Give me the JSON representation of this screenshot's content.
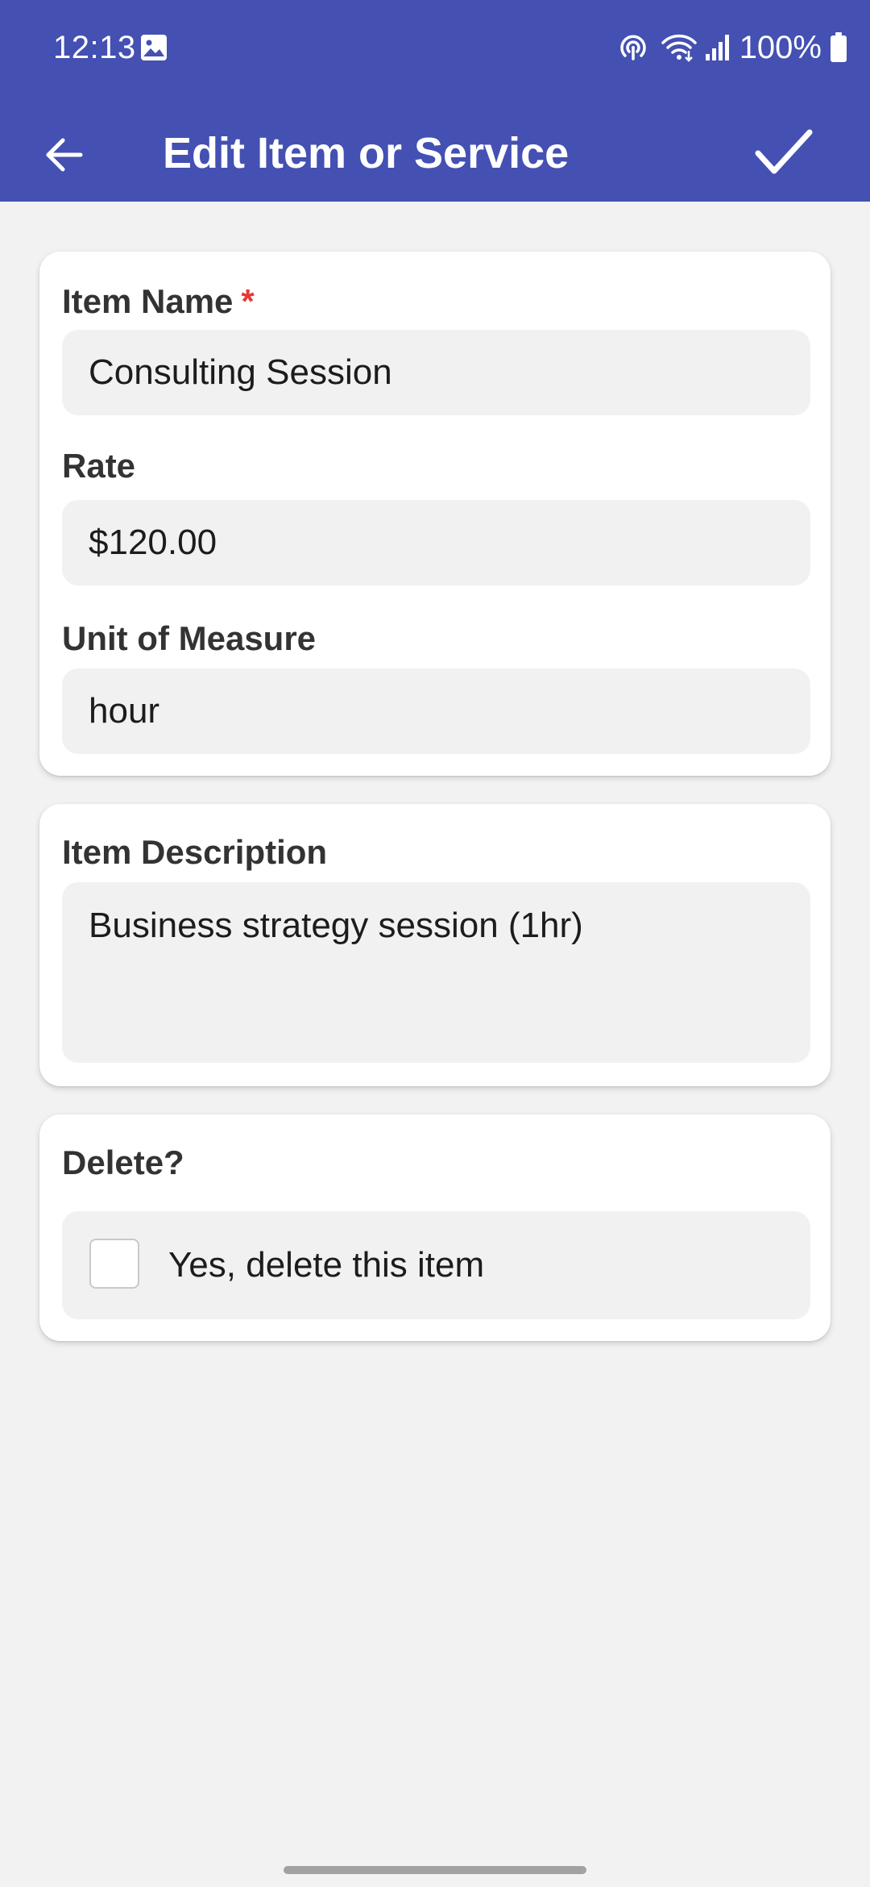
{
  "status_bar": {
    "time": "12:13",
    "battery": "100%",
    "icons": [
      "gallery-icon",
      "hotspot-icon",
      "wifi-icon",
      "signal-icon",
      "battery-icon"
    ]
  },
  "toolbar": {
    "title": "Edit Item or Service",
    "back_icon": "arrow-left-icon",
    "save_icon": "checkmark-icon"
  },
  "form": {
    "item_name": {
      "label": "Item Name",
      "required_mark": "*",
      "value": "Consulting Session"
    },
    "rate": {
      "label": "Rate",
      "value": "$120.00"
    },
    "unit": {
      "label": "Unit of Measure",
      "value": "hour"
    },
    "description": {
      "label": "Item Description",
      "value": "Business strategy session (1hr)"
    },
    "delete": {
      "label": "Delete?",
      "checkbox_label": "Yes, delete this item",
      "checked": false
    }
  },
  "colors": {
    "primary": "#4450b2",
    "background": "#f2f2f2",
    "field_background": "#f1f1f1",
    "required": "#e53935"
  }
}
